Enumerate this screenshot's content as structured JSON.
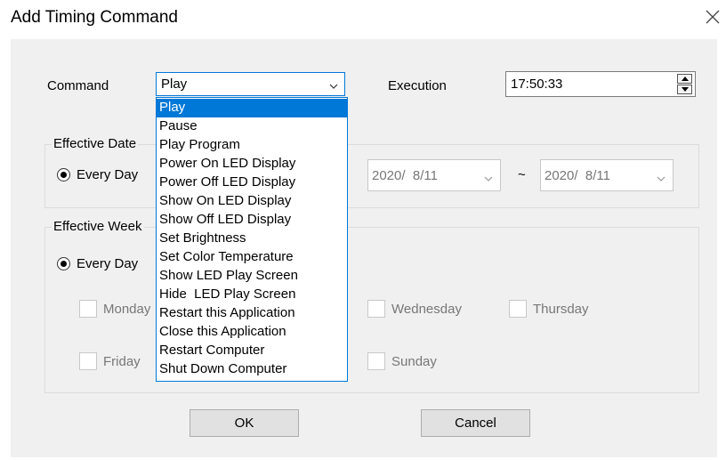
{
  "dialog": {
    "title": "Add Timing Command"
  },
  "command": {
    "label": "Command",
    "selected": "Play",
    "options": [
      "Play",
      "Pause",
      "Play Program",
      "Power On LED Display",
      "Power Off LED Display",
      "Show On LED Display",
      "Show Off LED Display",
      "Set Brightness",
      "Set Color Temperature",
      "Show LED Play Screen",
      "Hide  LED Play Screen",
      "Restart this Application",
      "Close this Application",
      "Restart Computer",
      "Shut Down Computer"
    ]
  },
  "execution": {
    "label": "Execution",
    "time": "17:50:33"
  },
  "effective_date": {
    "title": "Effective Date",
    "every_day_label": "Every Day",
    "start_date": "2020/  8/11",
    "separator": "~",
    "end_date": "2020/  8/11"
  },
  "effective_week": {
    "title": "Effective Week",
    "every_day_label": "Every Day",
    "days": {
      "monday": "Monday",
      "wednesday": "Wednesday",
      "thursday": "Thursday",
      "friday": "Friday",
      "sunday": "Sunday"
    }
  },
  "buttons": {
    "ok": "OK",
    "cancel": "Cancel"
  },
  "colors": {
    "accent": "#0078d7",
    "panel_bg": "#f0f0f0",
    "disabled_text": "#777777"
  }
}
